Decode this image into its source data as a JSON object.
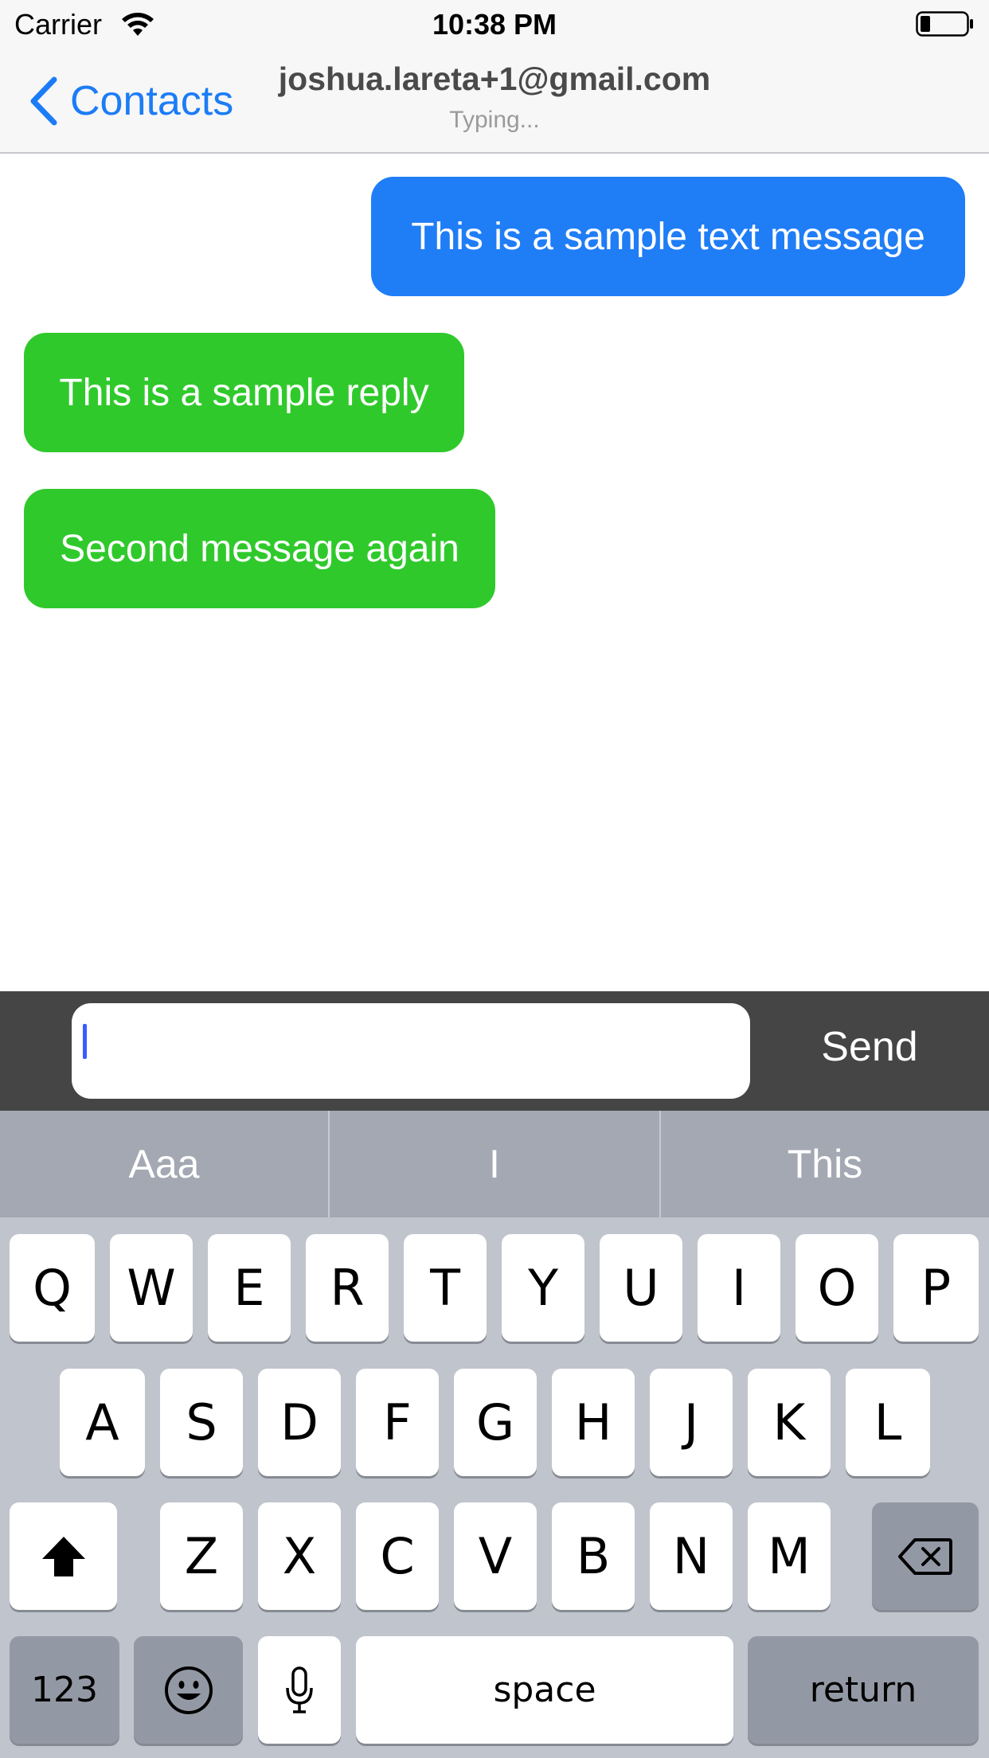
{
  "status_bar": {
    "carrier": "Carrier",
    "time": "10:38 PM",
    "wifi_icon": "wifi-icon",
    "battery_icon": "battery-low-icon"
  },
  "nav_bar": {
    "back_label": "Contacts",
    "title": "joshua.lareta+1@gmail.com",
    "subtitle": "Typing..."
  },
  "messages": [
    {
      "text": "This is a sample text message",
      "direction": "sent",
      "color": "#1f7df6"
    },
    {
      "text": "This is a sample reply",
      "direction": "received",
      "color": "#30c92c"
    },
    {
      "text": "Second message again",
      "direction": "received",
      "color": "#30c92c"
    }
  ],
  "composer": {
    "value": "",
    "send_label": "Send"
  },
  "keyboard": {
    "suggestions": [
      "Aaa",
      "I",
      "This"
    ],
    "row1": [
      "Q",
      "W",
      "E",
      "R",
      "T",
      "Y",
      "U",
      "I",
      "O",
      "P"
    ],
    "row2": [
      "A",
      "S",
      "D",
      "F",
      "G",
      "H",
      "J",
      "K",
      "L"
    ],
    "row3": [
      "Z",
      "X",
      "C",
      "V",
      "B",
      "N",
      "M"
    ],
    "numbers_label": "123",
    "space_label": "space",
    "return_label": "return",
    "shift_icon": "shift-icon",
    "delete_icon": "delete-icon",
    "emoji_icon": "emoji-icon",
    "mic_icon": "microphone-icon"
  }
}
